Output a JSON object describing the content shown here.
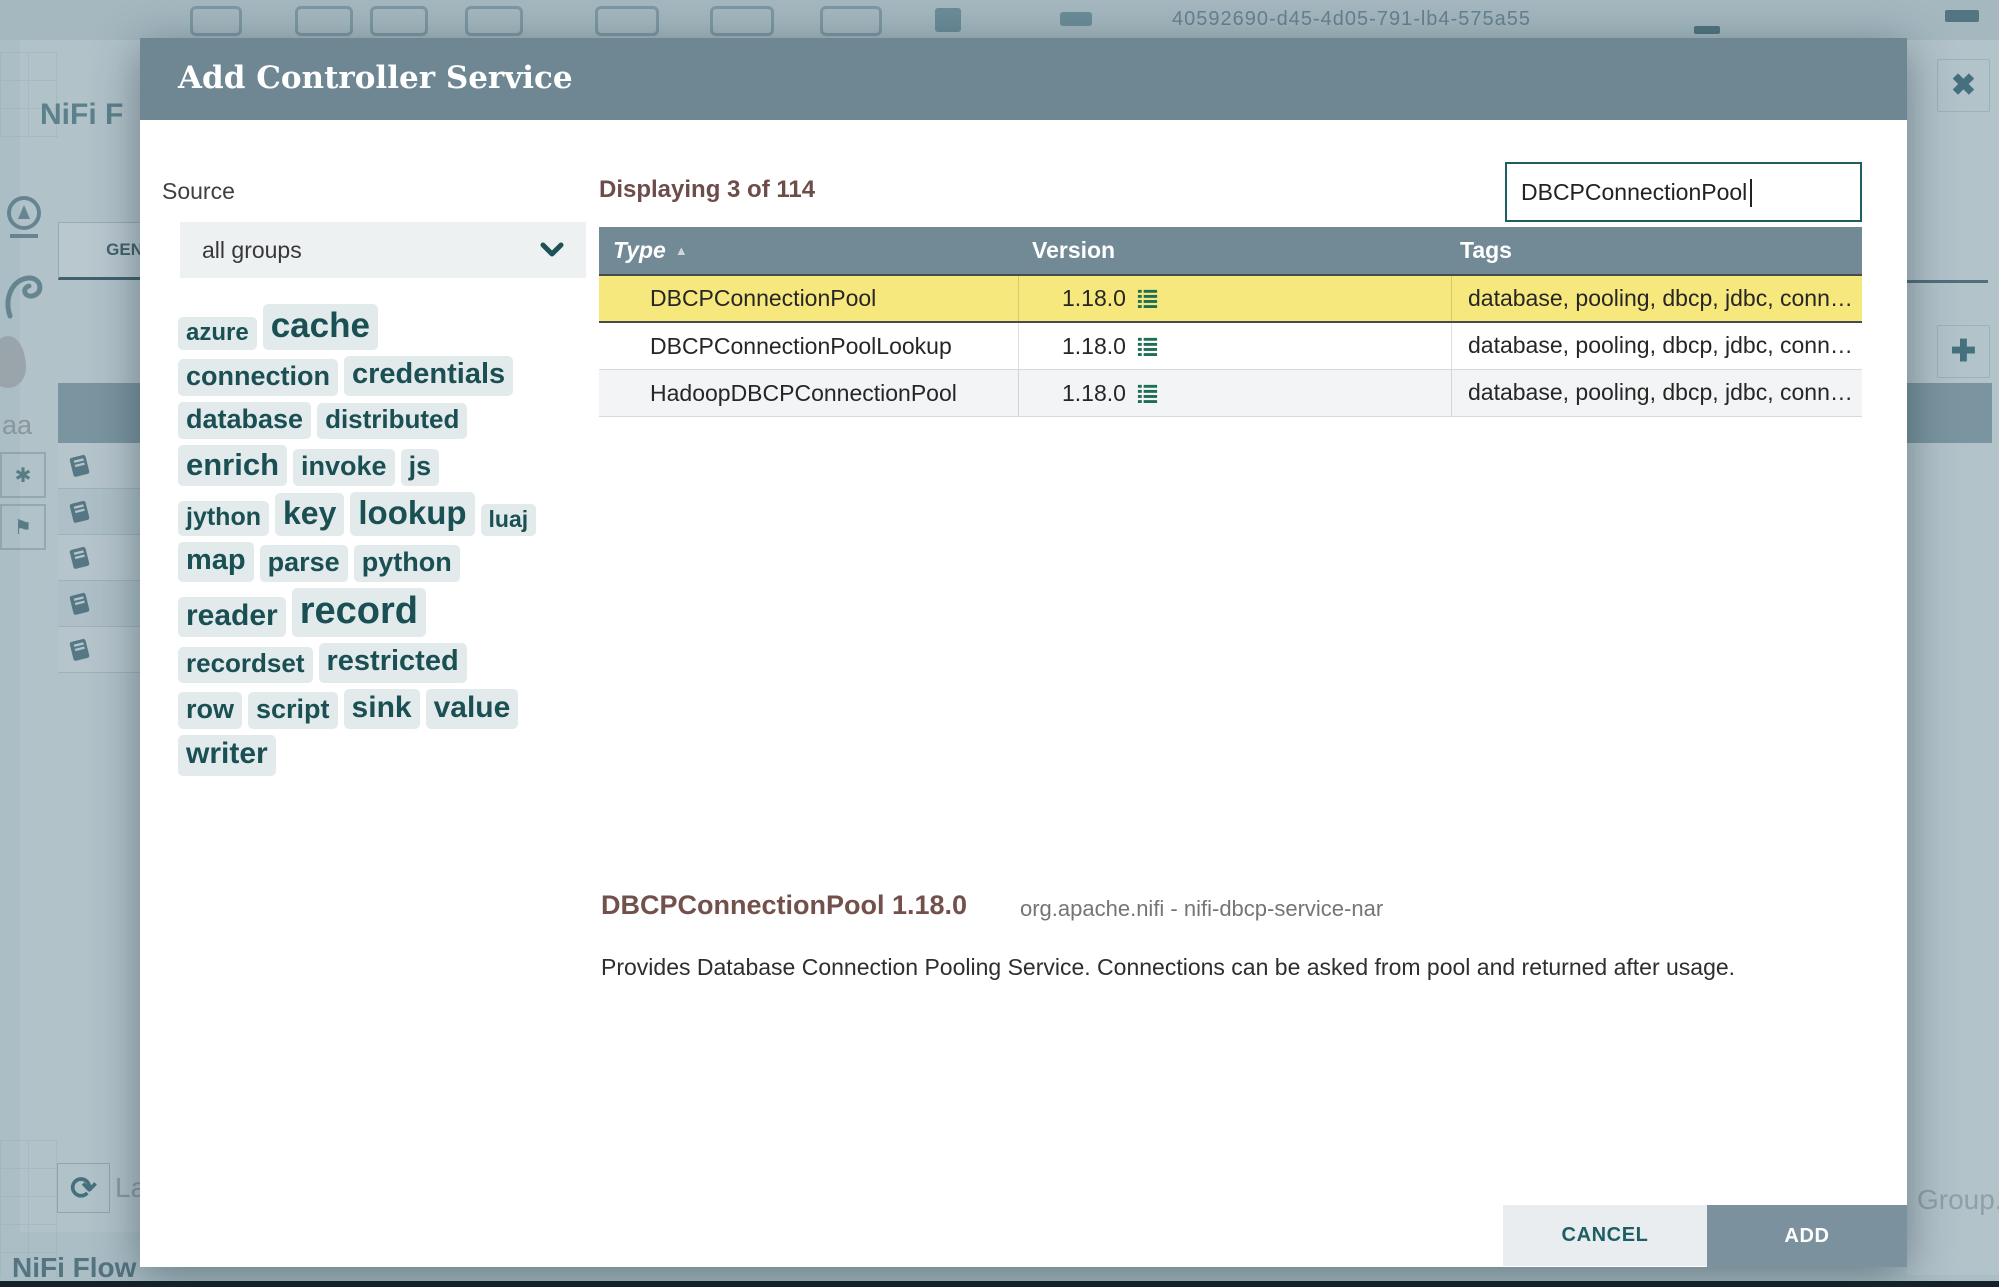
{
  "dialog": {
    "title": "Add Controller Service",
    "source": {
      "label": "Source",
      "selected_value": "all groups"
    },
    "displaying_text": "Displaying 3 of 114",
    "filter": {
      "value": "DBCPConnectionPool"
    },
    "table": {
      "columns": [
        {
          "label": "Type",
          "sort_indicator": "▲"
        },
        {
          "label": "Version"
        },
        {
          "label": "Tags"
        }
      ],
      "rows": [
        {
          "type": "DBCPConnectionPool",
          "version": "1.18.0",
          "tags": "database, pooling, dbcp, jdbc, connec…",
          "selected": true
        },
        {
          "type": "DBCPConnectionPoolLookup",
          "version": "1.18.0",
          "tags": "database, pooling, dbcp, jdbc, connec…",
          "selected": false
        },
        {
          "type": "HadoopDBCPConnectionPool",
          "version": "1.18.0",
          "tags": "database, pooling, dbcp, jdbc, connec…",
          "selected": false
        }
      ]
    },
    "tag_cloud_rows": [
      [
        {
          "label": "azure",
          "size": 24
        },
        {
          "label": "cache",
          "size": 35
        }
      ],
      [
        {
          "label": "connection",
          "size": 27
        },
        {
          "label": "credentials",
          "size": 29
        }
      ],
      [
        {
          "label": "database",
          "size": 27
        },
        {
          "label": "distributed",
          "size": 26
        }
      ],
      [
        {
          "label": "enrich",
          "size": 31
        },
        {
          "label": "invoke",
          "size": 27
        },
        {
          "label": "js",
          "size": 27
        }
      ],
      [
        {
          "label": "jython",
          "size": 25
        },
        {
          "label": "key",
          "size": 32
        },
        {
          "label": "lookup",
          "size": 33
        },
        {
          "label": "luaj",
          "size": 23
        }
      ],
      [
        {
          "label": "map",
          "size": 29
        },
        {
          "label": "parse",
          "size": 27
        },
        {
          "label": "python",
          "size": 27
        }
      ],
      [
        {
          "label": "reader",
          "size": 30
        },
        {
          "label": "record",
          "size": 38
        }
      ],
      [
        {
          "label": "recordset",
          "size": 26
        },
        {
          "label": "restricted",
          "size": 29
        }
      ],
      [
        {
          "label": "row",
          "size": 27
        },
        {
          "label": "script",
          "size": 27
        },
        {
          "label": "sink",
          "size": 30
        },
        {
          "label": "value",
          "size": 30
        }
      ],
      [
        {
          "label": "writer",
          "size": 30
        }
      ]
    ],
    "detail": {
      "title": "DBCPConnectionPool 1.18.0",
      "bundle": "org.apache.nifi - nifi-dbcp-service-nar",
      "description": "Provides Database Connection Pooling Service. Connections can be asked from pool and returned after usage."
    },
    "buttons": {
      "cancel": "CANCEL",
      "add": "ADD"
    }
  },
  "background": {
    "behind_dialog_title": "NiFi F",
    "tab_label": "GEN",
    "zoom_text": "aa",
    "last_refreshed_fragment": "La",
    "breadcrumb": "NiFi Flow",
    "group_fragment": "Group.",
    "uuid_fragment": "40592690-d45-4d05-791-lb4-575a55"
  },
  "colors": {
    "header": "#6e8793",
    "table_header": "#718a95",
    "selected_row": "#f6e87c",
    "accent_maroon": "#6e4c49",
    "accent_teal": "#1a5054",
    "add_button": "#7b929e"
  }
}
